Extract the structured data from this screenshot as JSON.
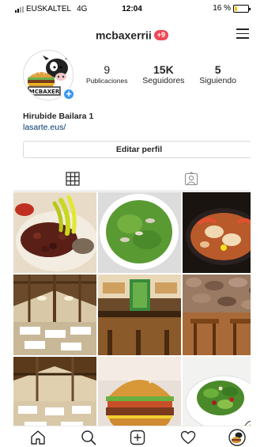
{
  "status": {
    "carrier": "EUSKALTEL",
    "network": "4G",
    "time": "12:04",
    "battery_text": "16 %",
    "battery_level": 0.16,
    "battery_color": "#f5c400"
  },
  "header": {
    "username": "mcbaxerrii",
    "notification_badge": "+9"
  },
  "profile": {
    "avatar_text": "MCBAXER",
    "stats": [
      {
        "value": "9",
        "label": "Publicaciones"
      },
      {
        "value": "15K",
        "label": "Seguidores"
      },
      {
        "value": "5",
        "label": "Siguiendo"
      }
    ],
    "name": "Hirubide Bailara 1",
    "link": "lasarte.eus/",
    "edit_button": "Editar perfil"
  },
  "tabs": [
    {
      "icon": "grid-icon",
      "active": true
    },
    {
      "icon": "tagged-icon",
      "active": false
    }
  ],
  "posts": [
    {
      "subject": "olives-and-peppers"
    },
    {
      "subject": "peas-dish"
    },
    {
      "subject": "seafood-plate"
    },
    {
      "subject": "dining-hall-beams"
    },
    {
      "subject": "bar-counter"
    },
    {
      "subject": "stone-wall-room"
    },
    {
      "subject": "dining-hall-tables"
    },
    {
      "subject": "burger"
    },
    {
      "subject": "salad"
    }
  ],
  "bottom_nav": [
    {
      "icon": "home-icon"
    },
    {
      "icon": "search-icon"
    },
    {
      "icon": "new-post-icon"
    },
    {
      "icon": "heart-icon"
    },
    {
      "icon": "profile-avatar-icon"
    }
  ],
  "colors": {
    "accent_blue": "#3897f0",
    "badge_red": "#ed4956",
    "link": "#003569"
  }
}
